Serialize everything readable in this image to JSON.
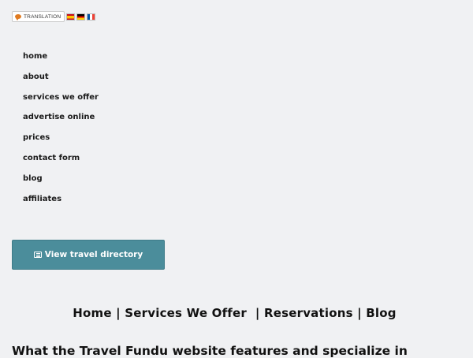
{
  "translation": {
    "label": "TRANSLATION",
    "flags": [
      "spanish-flag",
      "german-flag",
      "french-flag"
    ],
    "accent_color": "#e07b21"
  },
  "nav": {
    "items": [
      {
        "label": "home"
      },
      {
        "label": "about"
      },
      {
        "label": "services we offer"
      },
      {
        "label": "advertise online"
      },
      {
        "label": "prices"
      },
      {
        "label": "contact form"
      },
      {
        "label": "blog"
      },
      {
        "label": "affiliates"
      }
    ]
  },
  "directory_button": {
    "label": "View travel directory",
    "icon": "list-icon",
    "color": "#4b8d9b"
  },
  "footer_links": {
    "home": "Home",
    "services": "Services We Offer",
    "reservations": "Reservations",
    "blog": "Blog",
    "separator": "|"
  },
  "section": {
    "heading": "What the Travel Fundu website features and specialize in"
  }
}
